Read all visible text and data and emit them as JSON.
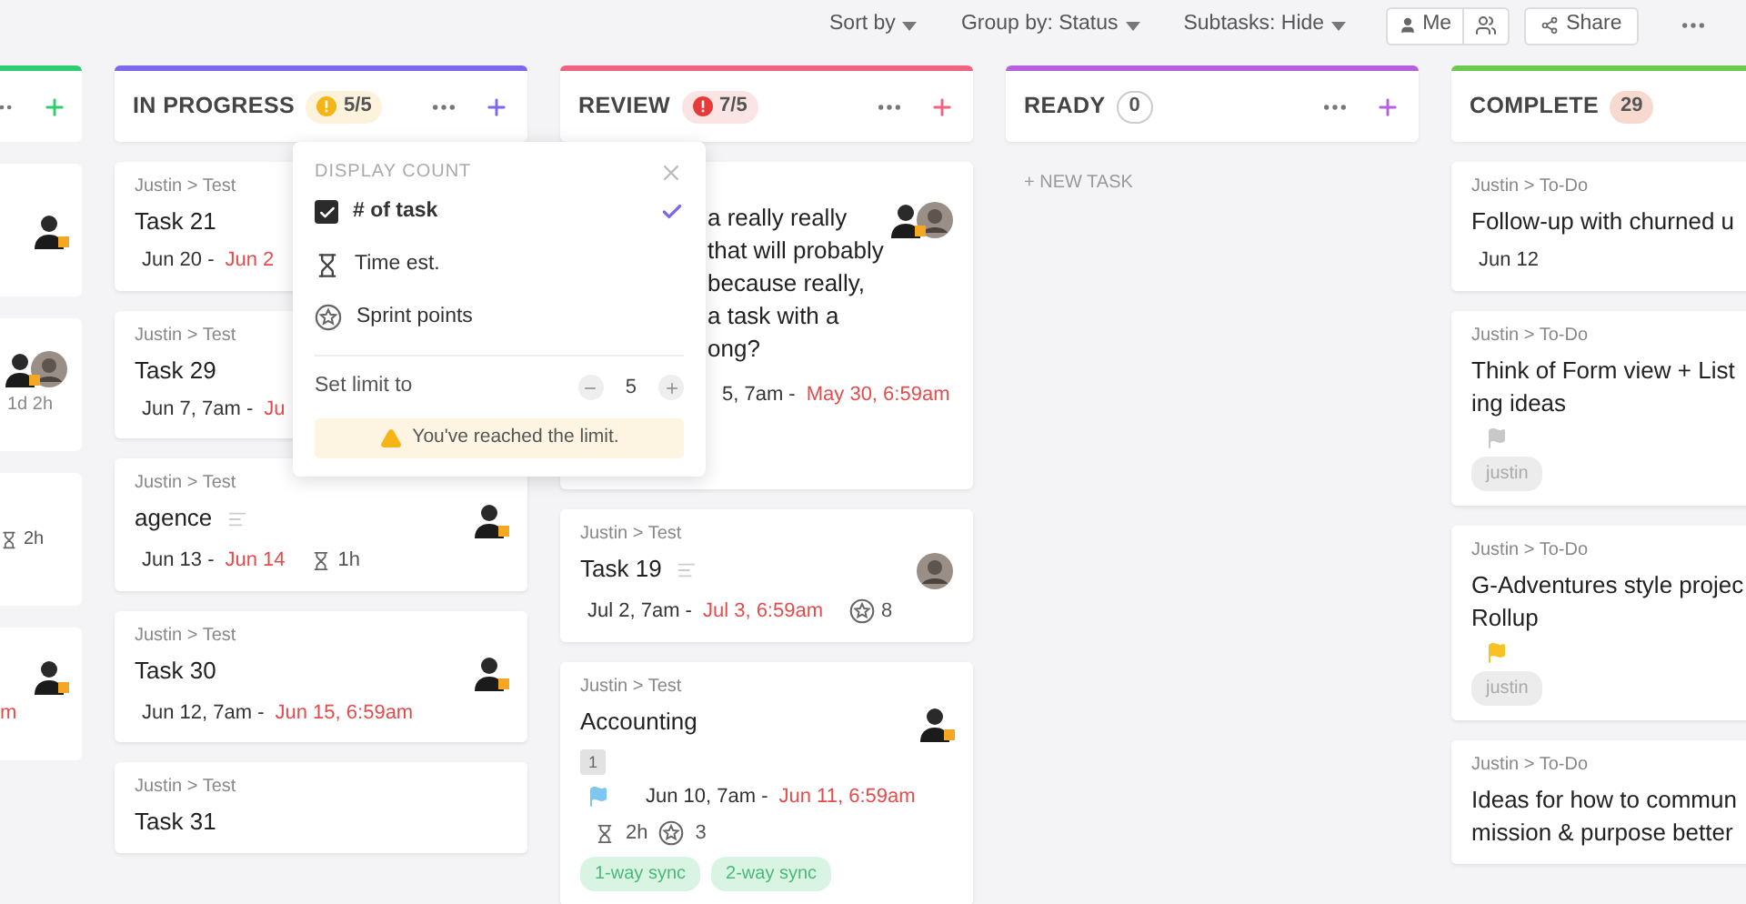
{
  "toolbar": {
    "sort": "Sort by",
    "group": "Group by: Status",
    "subtasks": "Subtasks: Hide",
    "me": "Me",
    "share": "Share"
  },
  "edge_column": {
    "color": "#2ecd6f",
    "cards": [
      {
        "avatars": [
          {
            "kind": "person"
          }
        ]
      },
      {
        "avatars": [
          {
            "kind": "person"
          },
          {
            "kind": "photo"
          }
        ],
        "time": "1d 2h"
      },
      {
        "time_est": "2h"
      },
      {
        "avatars": [
          {
            "kind": "person"
          }
        ],
        "due": "m"
      }
    ]
  },
  "columns": [
    {
      "name": "IN PROGRESS",
      "color": "#7b68ee",
      "count": {
        "text": "5/5",
        "kind": "warning"
      },
      "cards": [
        {
          "breadcrumb": "Justin > Test",
          "title_lines": [
            "Task 21"
          ],
          "start": "Jun 20 -",
          "due": "Jun 2"
        },
        {
          "breadcrumb": "Justin > Test",
          "title_lines": [
            "Task 29"
          ],
          "start": "Jun 7, 7am -",
          "due": "Ju"
        },
        {
          "breadcrumb": "Justin > Test",
          "title_lines": [
            "agence"
          ],
          "description": true,
          "start": "Jun 13 -",
          "due": "Jun 14",
          "time_est": "1h",
          "avatars": [
            {
              "kind": "person"
            }
          ]
        },
        {
          "breadcrumb": "Justin > Test",
          "title_lines": [
            "Task 30"
          ],
          "start": "Jun 12, 7am -",
          "due": "Jun 15, 6:59am",
          "avatars": [
            {
              "kind": "person"
            }
          ]
        },
        {
          "breadcrumb": "Justin > Test",
          "title_lines": [
            "Task 31"
          ]
        }
      ]
    },
    {
      "name": "REVIEW",
      "color": "#f2637f",
      "count": {
        "text": "7/5",
        "kind": "error"
      },
      "cards": [
        {
          "covered": true,
          "title_lines": [
            "a really really",
            "that will probably",
            "because really,",
            "a task with a",
            "ong?"
          ],
          "start": "5, 7am -",
          "due": "May 30, 6:59am",
          "avatars": [
            {
              "kind": "person"
            },
            {
              "kind": "photo"
            }
          ]
        },
        {
          "breadcrumb": "Justin > Test",
          "title_lines": [
            "Task 19"
          ],
          "description": true,
          "start": "Jul 2, 7am -",
          "due": "Jul 3, 6:59am",
          "points": "8",
          "avatars": [
            {
              "kind": "photo"
            }
          ]
        },
        {
          "breadcrumb": "Justin > Test",
          "title_lines": [
            "Accounting"
          ],
          "subtasks": "1",
          "flag": {
            "color": "#7cc8f0"
          },
          "start": "Jun 10, 7am -",
          "due": "Jun 11, 6:59am",
          "time_est": "2h",
          "points": "3",
          "tags": [
            "1-way sync",
            "2-way sync"
          ],
          "avatars": [
            {
              "kind": "person"
            }
          ]
        }
      ]
    },
    {
      "name": "READY",
      "color": "#b660e0",
      "count": {
        "text": "0",
        "kind": "plain"
      },
      "new_task": "+ NEW TASK"
    },
    {
      "name": "COMPLETE",
      "color": "#6bc950",
      "count": {
        "text": "29",
        "kind": "filled"
      },
      "cards": [
        {
          "breadcrumb": "Justin > To-Do",
          "title_lines": [
            "Follow-up with churned u"
          ],
          "start": "Jun 12"
        },
        {
          "breadcrumb": "Justin > To-Do",
          "title_lines": [
            "Think of Form view + List",
            "ing ideas"
          ],
          "flag": {
            "color": "#c8c8c8"
          },
          "tags": [
            "justin"
          ]
        },
        {
          "breadcrumb": "Justin > To-Do",
          "title_lines": [
            "G-Adventures style projec",
            "Rollup"
          ],
          "flag": {
            "color": "#f7c324"
          },
          "tags": [
            "justin"
          ]
        },
        {
          "breadcrumb": "Justin > To-Do",
          "title_lines": [
            "Ideas for how to commun",
            "mission & purpose better"
          ]
        }
      ]
    }
  ],
  "popover": {
    "title": "DISPLAY COUNT",
    "options": [
      {
        "kind": "checkbox",
        "label": "# of task",
        "checked": true,
        "selected": true
      },
      {
        "kind": "hourglass",
        "label": "Time est.",
        "selected": false
      },
      {
        "kind": "star",
        "label": "Sprint points",
        "selected": false
      }
    ],
    "limit_label": "Set limit to",
    "limit": "5",
    "warning": "You've reached the limit."
  }
}
